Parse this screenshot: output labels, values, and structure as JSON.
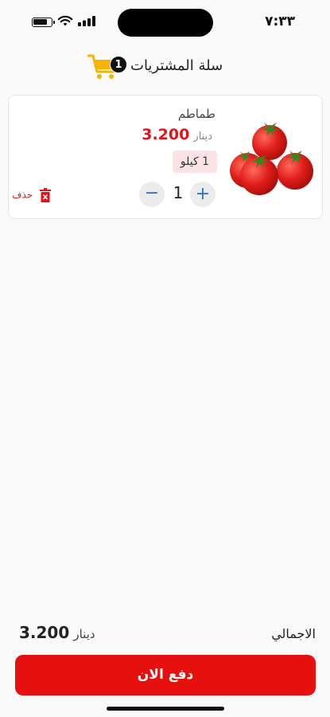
{
  "status_bar": {
    "time": "٧:٣٣"
  },
  "header": {
    "title": "سلة المشتريات",
    "cart_count": "1"
  },
  "cart_items": [
    {
      "name": "طماطم",
      "price": "3.200",
      "currency": "دينار",
      "unit": "1 كيلو",
      "quantity": "1",
      "plus_label": "+",
      "minus_label": "−",
      "delete_label": "حذف"
    }
  ],
  "footer": {
    "total_label": "الاجمالي",
    "total_value": "3.200",
    "total_currency": "دينار",
    "pay_label": "دفع الان"
  },
  "colors": {
    "accent": "#e6100f",
    "cart_icon": "#f5b400",
    "qty_icon": "#2f6fd6"
  }
}
